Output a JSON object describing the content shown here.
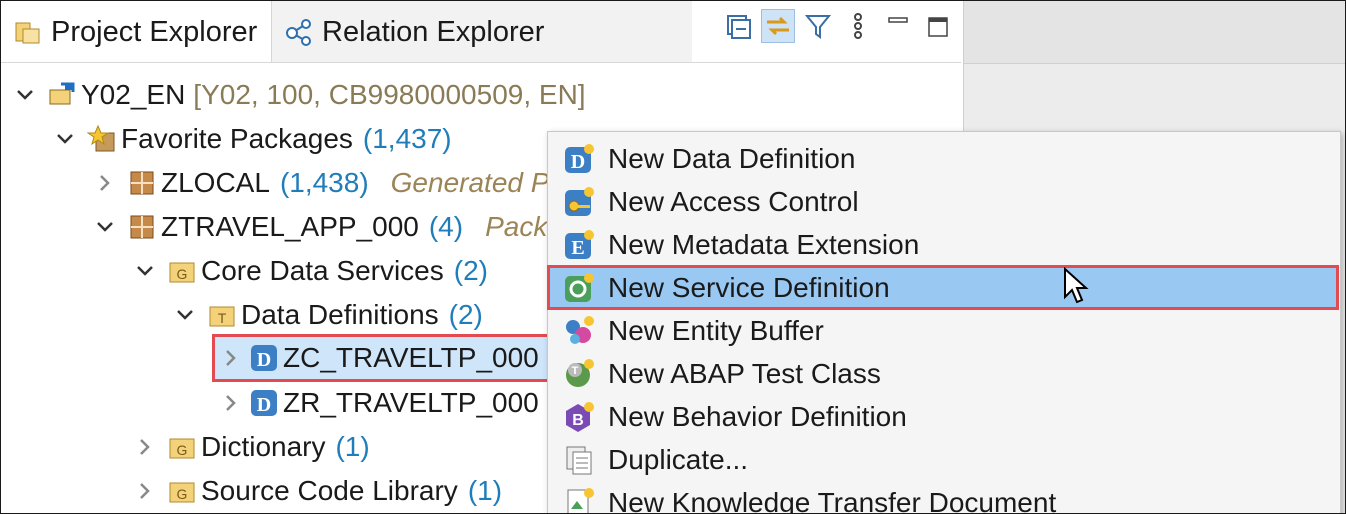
{
  "tabs": [
    {
      "label": "Project Explorer",
      "icon": "project-explorer-icon",
      "active": true
    },
    {
      "label": "Relation Explorer",
      "icon": "relation-explorer-icon",
      "active": false
    }
  ],
  "toolbar": [
    {
      "icon": "collapse-all-icon"
    },
    {
      "icon": "link-with-editor-icon",
      "pressed": true
    },
    {
      "icon": "filter-icon"
    },
    {
      "icon": "view-menu-icon"
    },
    {
      "icon": "minimize-icon"
    },
    {
      "icon": "maximize-icon"
    }
  ],
  "tree": {
    "project": {
      "label": "Y02_EN",
      "meta": "[Y02, 100, CB9980000509, EN]"
    },
    "favorites": {
      "label": "Favorite Packages",
      "count": "(1,437)"
    },
    "zlocal": {
      "label": "ZLOCAL",
      "count": "(1,438)",
      "desc": "Generated P"
    },
    "ztravel": {
      "label": "ZTRAVEL_APP_000",
      "count": "(4)",
      "desc": "Packa"
    },
    "cds": {
      "label": "Core Data Services",
      "count": "(2)"
    },
    "datadefs": {
      "label": "Data Definitions",
      "count": "(2)"
    },
    "zc": {
      "label": "ZC_TRAVELTP_000"
    },
    "zr": {
      "label": "ZR_TRAVELTP_000"
    },
    "dictionary": {
      "label": "Dictionary",
      "count": "(1)"
    },
    "scl": {
      "label": "Source Code Library",
      "count": "(1)"
    }
  },
  "menu": {
    "items": [
      {
        "label": "New Data Definition",
        "icon": "data-definition-icon"
      },
      {
        "label": "New Access Control",
        "icon": "access-control-icon"
      },
      {
        "label": "New Metadata Extension",
        "icon": "metadata-extension-icon"
      },
      {
        "label": "New Service Definition",
        "icon": "service-definition-icon",
        "highlighted": true
      },
      {
        "label": "New Entity Buffer",
        "icon": "entity-buffer-icon"
      },
      {
        "label": "New ABAP Test Class",
        "icon": "abap-test-class-icon"
      },
      {
        "label": "New Behavior Definition",
        "icon": "behavior-definition-icon"
      },
      {
        "label": "Duplicate...",
        "icon": "duplicate-icon"
      },
      {
        "label": "New Knowledge Transfer Document",
        "icon": "knowledge-transfer-icon"
      }
    ]
  },
  "colors": {
    "selection": "#cfe5fa",
    "highlight_border": "#e34b50",
    "menu_highlight": "#99c8f2",
    "count": "#1f7dba"
  }
}
